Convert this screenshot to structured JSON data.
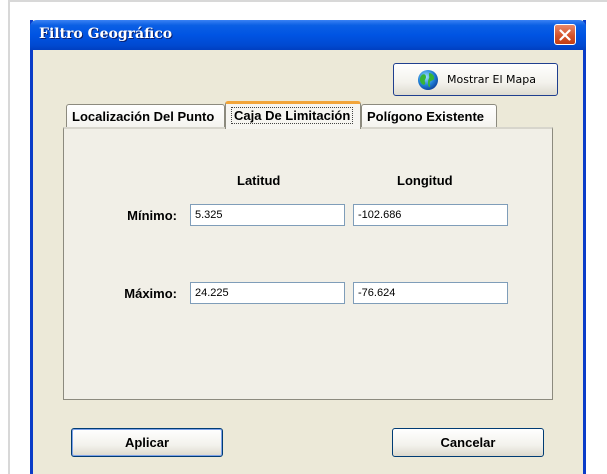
{
  "window": {
    "title": "Filtro Geográfico"
  },
  "toolbar": {
    "map_button_label": "Mostrar El Mapa"
  },
  "tabs": [
    {
      "label": "Localización Del Punto",
      "active": false
    },
    {
      "label": "Caja De Limitación",
      "active": true
    },
    {
      "label": "Polígono Existente",
      "active": false
    }
  ],
  "bbox_form": {
    "headers": {
      "lat": "Latitud",
      "lon": "Longitud"
    },
    "min": {
      "label": "Mínimo:",
      "lat": "5.325",
      "lon": "-102.686"
    },
    "max": {
      "label": "Máximo:",
      "lat": "24.225",
      "lon": "-76.624"
    }
  },
  "actions": {
    "apply_label": "Aplicar",
    "cancel_label": "Cancelar"
  },
  "colors": {
    "titlebar": "#0054e3",
    "close_button": "#d6542c",
    "dialog_bg": "#ece9d8",
    "active_tab_accent": "#f2a53a"
  },
  "icons": {
    "close": "close-icon",
    "map": "globe-icon"
  }
}
